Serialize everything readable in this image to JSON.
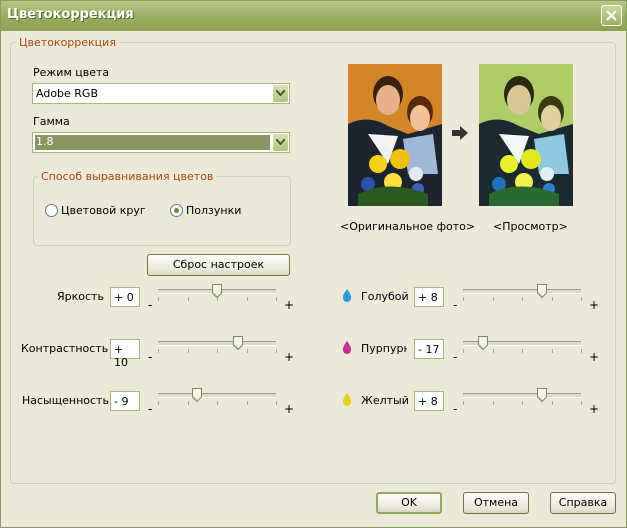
{
  "window": {
    "title": "Цветокоррекция"
  },
  "group": {
    "legend": "Цветокоррекция"
  },
  "color_mode": {
    "label": "Режим цвета",
    "value": "Adobe RGB"
  },
  "gamma": {
    "label": "Гамма",
    "value": "1.8"
  },
  "alignment": {
    "legend": "Способ выравнивания цветов",
    "options": [
      {
        "label": "Цветовой круг",
        "selected": false
      },
      {
        "label": "Ползунки",
        "selected": true
      }
    ]
  },
  "reset_button": "Сброс настроек",
  "preview": {
    "original_caption": "<Оригинальное фото>",
    "preview_caption": "<Просмотр>"
  },
  "sliders_left": [
    {
      "label": "Яркость",
      "value": "+ 0",
      "level": 0.5
    },
    {
      "label": "Контрастность",
      "value": "+ 10",
      "level": 0.68
    },
    {
      "label": "Насыщенность",
      "value": "- 9",
      "level": 0.33
    }
  ],
  "sliders_right": [
    {
      "label": "Голубой",
      "value": "+ 8",
      "level": 0.67,
      "color": "#2C9CD8"
    },
    {
      "label": "Пурпурный",
      "value": "- 17",
      "level": 0.17,
      "color": "#C8308C"
    },
    {
      "label": "Желтый",
      "value": "+ 8",
      "level": 0.67,
      "color": "#E8D020"
    }
  ],
  "minus_sign": "-",
  "plus_sign": "+",
  "buttons": {
    "ok": "OK",
    "cancel": "Отмена",
    "help": "Справка"
  }
}
